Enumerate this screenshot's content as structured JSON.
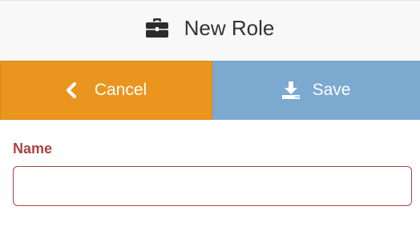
{
  "header": {
    "title": "New Role",
    "icon": "briefcase-icon"
  },
  "actions": {
    "cancel_label": "Cancel",
    "cancel_icon": "chevron-left-icon",
    "cancel_color": "#ea961e",
    "save_label": "Save",
    "save_icon": "download-icon",
    "save_color": "#7ba9d0"
  },
  "form": {
    "name_label": "Name",
    "name_value": "",
    "name_placeholder": "",
    "error_color": "#a94442"
  }
}
